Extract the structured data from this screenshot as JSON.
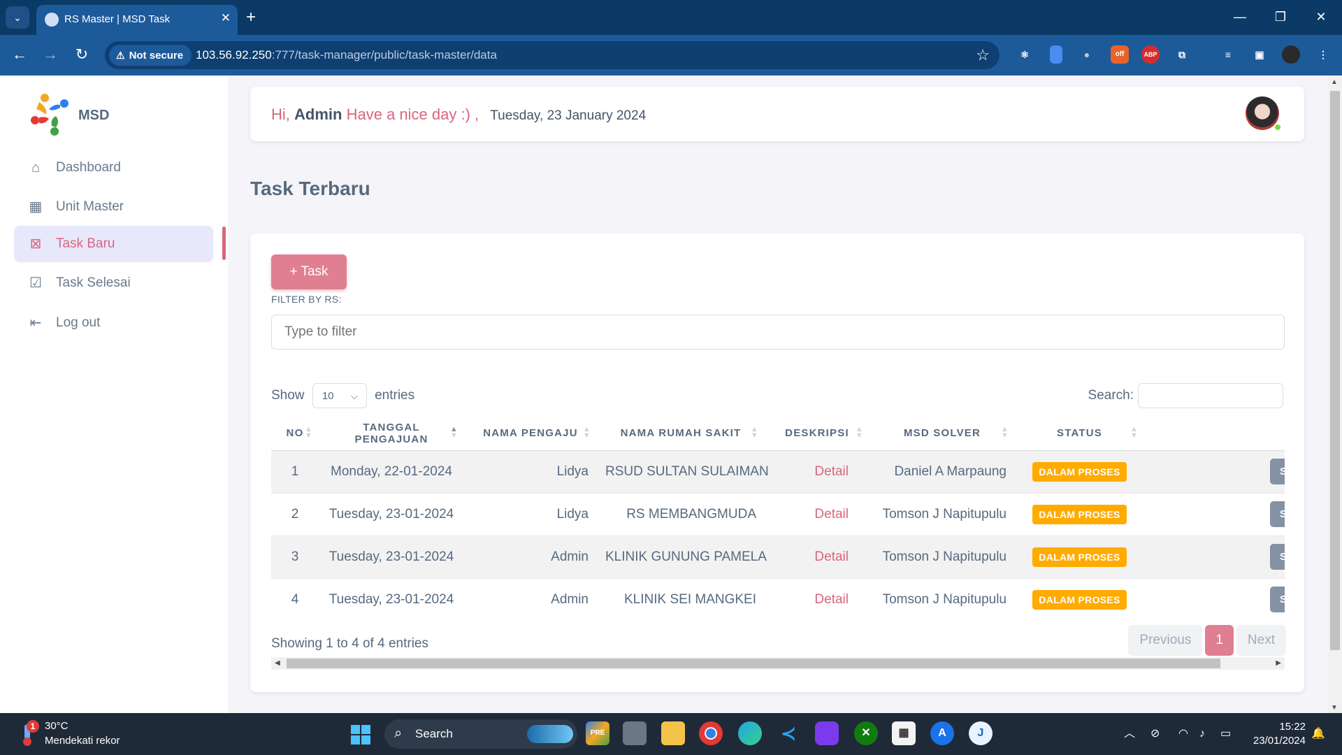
{
  "browser": {
    "tab_title": "RS Master | MSD Task",
    "security_label": "Not secure",
    "url_host": "103.56.92.250",
    "url_path": ":777/task-manager/public/task-master/data"
  },
  "sidebar": {
    "brand": "MSD",
    "items": [
      {
        "label": "Dashboard",
        "icon": "home-icon"
      },
      {
        "label": "Unit Master",
        "icon": "table-icon"
      },
      {
        "label": "Task Baru",
        "icon": "clipboard-x-icon"
      },
      {
        "label": "Task Selesai",
        "icon": "clipboard-check-icon"
      },
      {
        "label": "Log out",
        "icon": "logout-icon"
      }
    ],
    "active_index": 2
  },
  "header": {
    "hi": "Hi,",
    "user": "Admin",
    "message": "Have a nice day :) ,",
    "date": "Tuesday, 23 January 2024"
  },
  "page": {
    "title": "Task Terbaru",
    "add_button": "+ Task",
    "filter_label": "FILTER BY RS:",
    "filter_placeholder": "Type to filter",
    "show_label": "Show",
    "show_value": "10",
    "entries_label": "entries",
    "search_label": "Search:"
  },
  "table": {
    "columns": [
      "NO",
      "TANGGAL PENGAJUAN",
      "NAMA PENGAJU",
      "NAMA RUMAH SAKIT",
      "DESKRIPSI",
      "MSD SOLVER",
      "STATUS",
      "#"
    ],
    "rows": [
      {
        "no": "1",
        "date": "Monday, 22-01-2024",
        "pengaju": "Lidya",
        "rs": "RSUD SULTAN SULAIMAN",
        "desc": "Detail",
        "solver": "Daniel A Marpaung",
        "status": "DALAM PROSES",
        "action": "Selesai"
      },
      {
        "no": "2",
        "date": "Tuesday, 23-01-2024",
        "pengaju": "Lidya",
        "rs": "RS MEMBANGMUDA",
        "desc": "Detail",
        "solver": "Tomson J Napitupulu",
        "status": "DALAM PROSES",
        "action": "Selesai"
      },
      {
        "no": "3",
        "date": "Tuesday, 23-01-2024",
        "pengaju": "Admin",
        "rs": "KLINIK GUNUNG PAMELA",
        "desc": "Detail",
        "solver": "Tomson J Napitupulu",
        "status": "DALAM PROSES",
        "action": "Selesai"
      },
      {
        "no": "4",
        "date": "Tuesday, 23-01-2024",
        "pengaju": "Admin",
        "rs": "KLINIK SEI MANGKEI",
        "desc": "Detail",
        "solver": "Tomson J Napitupulu",
        "status": "DALAM PROSES",
        "action": "Selesai"
      }
    ],
    "info": "Showing 1 to 4 of 4 entries",
    "prev": "Previous",
    "page": "1",
    "next": "Next"
  },
  "taskbar": {
    "temp": "30°C",
    "weather": "Mendekati rekor",
    "notif_count": "1",
    "search": "Search",
    "time": "15:22",
    "date": "23/01/2024"
  },
  "colors": {
    "accent": "#d9657f",
    "status_badge": "#ffab00",
    "browser_frame": "#1d5a9a"
  }
}
